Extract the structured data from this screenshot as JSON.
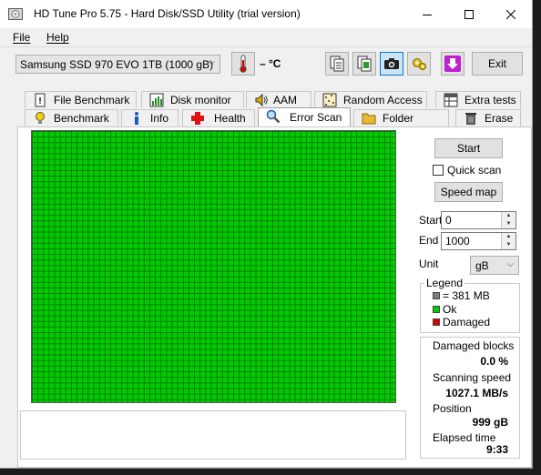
{
  "window": {
    "title": "HD Tune Pro 5.75 - Hard Disk/SSD Utility (trial version)"
  },
  "menu": {
    "file": "File",
    "help": "Help"
  },
  "toolbar": {
    "drive": "Samsung SSD 970 EVO 1TB (1000 gB)",
    "temperature": "– °C",
    "exit": "Exit"
  },
  "tabs_top": [
    "File Benchmark",
    "Disk monitor",
    "AAM",
    "Random Access",
    "Extra tests"
  ],
  "tabs_bottom": [
    "Benchmark",
    "Info",
    "Health",
    "Error Scan",
    "Folder Usage",
    "Erase"
  ],
  "active_tab": "Error Scan",
  "controls": {
    "start": "Start",
    "quick_scan": "Quick scan",
    "speed_map": "Speed map",
    "start_label": "Start",
    "start_value": "0",
    "end_label": "End",
    "end_value": "1000",
    "unit_label": "Unit",
    "unit_value": "gB"
  },
  "legend": {
    "title": "Legend",
    "block": "= 381 MB",
    "ok": "Ok",
    "damaged": "Damaged",
    "colors": {
      "block": "#808080",
      "ok": "#00cc00",
      "damaged": "#dd0000"
    }
  },
  "stats": {
    "damaged_blocks_label": "Damaged blocks",
    "damaged_blocks_value": "0.0 %",
    "scanning_speed_label": "Scanning speed",
    "scanning_speed_value": "1027.1 MB/s",
    "position_label": "Position",
    "position_value": "999 gB",
    "elapsed_label": "Elapsed time",
    "elapsed_value": "9:33"
  }
}
